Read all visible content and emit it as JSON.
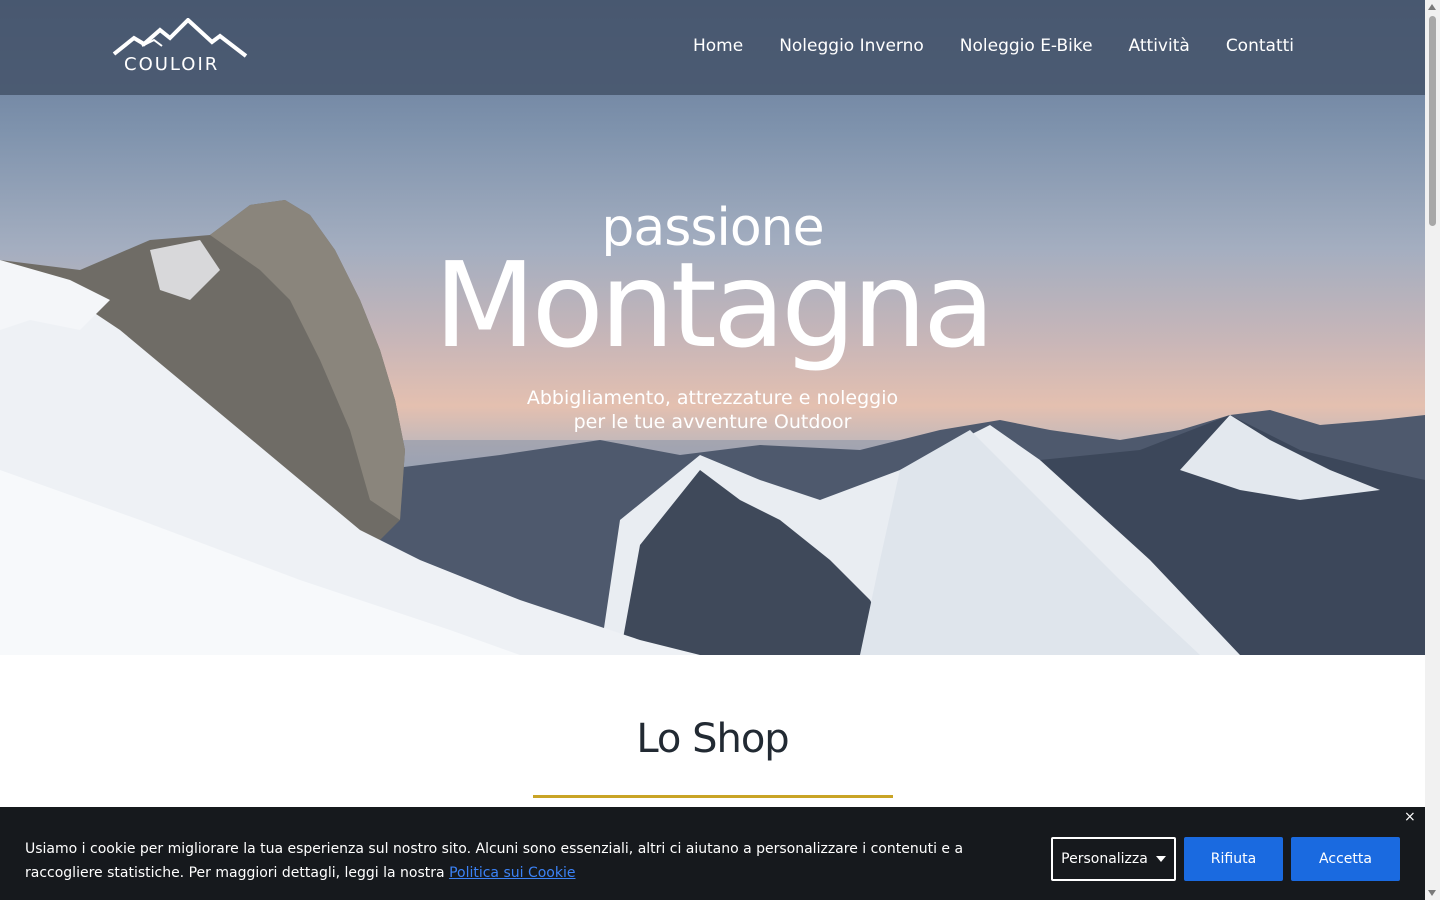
{
  "header": {
    "logo_text": "COULOIR",
    "nav": [
      {
        "label": "Home"
      },
      {
        "label": "Noleggio Inverno"
      },
      {
        "label": "Noleggio E-Bike"
      },
      {
        "label": "Attività"
      },
      {
        "label": "Contatti"
      }
    ]
  },
  "hero": {
    "small_title": "passione",
    "big_title": "Montagna",
    "subtitle_line1": "Abbigliamento, attrezzature e noleggio",
    "subtitle_line2": "per le tue avventure Outdoor"
  },
  "shop": {
    "title": "Lo Shop",
    "underline_color": "#c9a426"
  },
  "cookie_banner": {
    "text": "Usiamo i cookie per migliorare la tua esperienza sul nostro sito. Alcuni sono essenziali, altri ci aiutano a personalizzare i contenuti e a raccogliere statistiche. Per maggiori dettagli, leggi la nostra",
    "link_text": "Politica sui Cookie",
    "personalize_label": "Personalizza",
    "reject_label": "Rifiuta",
    "accept_label": "Accetta",
    "close_symbol": "×",
    "button_color": "#1a6ae0"
  }
}
